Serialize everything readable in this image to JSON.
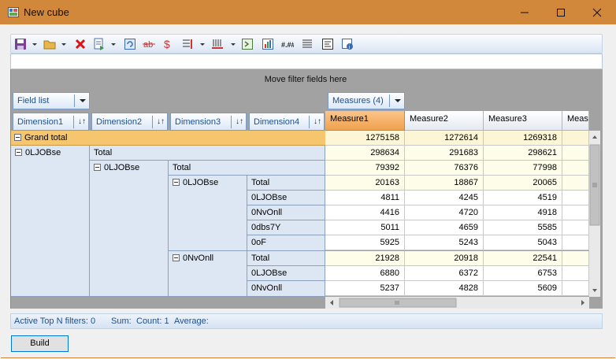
{
  "window": {
    "title": "New cube"
  },
  "filter_area": {
    "hint": "Move filter fields here"
  },
  "field_list": {
    "label": "Field list"
  },
  "measures_button": {
    "label": "Measures (4)"
  },
  "dimensions": [
    "Dimension1",
    "Dimension2",
    "Dimension3",
    "Dimension4"
  ],
  "measures": [
    "Measure1",
    "Measure2",
    "Measure3",
    "Meası"
  ],
  "grand_total": {
    "label": "Grand total",
    "values": [
      "1275158",
      "1272614",
      "1269318"
    ]
  },
  "row_headers": {
    "l1": "0LJOBse",
    "l1_total": "Total",
    "l2": "0LJOBse",
    "l2_total": "Total",
    "l3a": "0LJOBse",
    "l3a_items": [
      "Total",
      "0LJOBse",
      "0NvOnll",
      "0dbs7Y",
      "0oF"
    ],
    "l3b": "0NvOnll",
    "l3b_items": [
      "Total",
      "0LJOBse",
      "0NvOnll"
    ]
  },
  "rows": [
    {
      "values": [
        "298634",
        "291683",
        "298621"
      ],
      "subtotal": true
    },
    {
      "values": [
        "79392",
        "76376",
        "77998"
      ],
      "subtotal": true
    },
    {
      "values": [
        "20163",
        "18867",
        "20065"
      ],
      "subtotal": true
    },
    {
      "values": [
        "4811",
        "4245",
        "4519"
      ],
      "subtotal": false
    },
    {
      "values": [
        "4416",
        "4720",
        "4918"
      ],
      "subtotal": false
    },
    {
      "values": [
        "5011",
        "4659",
        "5585"
      ],
      "subtotal": false
    },
    {
      "values": [
        "5925",
        "5243",
        "5043"
      ],
      "subtotal": false
    },
    {
      "values": [
        "21928",
        "20918",
        "22541"
      ],
      "subtotal": true
    },
    {
      "values": [
        "6880",
        "6372",
        "6753"
      ],
      "subtotal": false
    },
    {
      "values": [
        "5237",
        "4828",
        "5609"
      ],
      "subtotal": false
    }
  ],
  "status": {
    "top_n": "Active Top N filters: 0",
    "sum": "Sum:",
    "count": "Count: 1",
    "average": "Average:"
  },
  "build_button": {
    "label": "Build"
  },
  "colors": {
    "titlebar": "#d1883a",
    "grand_total_row": "#f6c66f",
    "active_measure": "#f0a14e",
    "header_blue": "#1e4f8f"
  }
}
